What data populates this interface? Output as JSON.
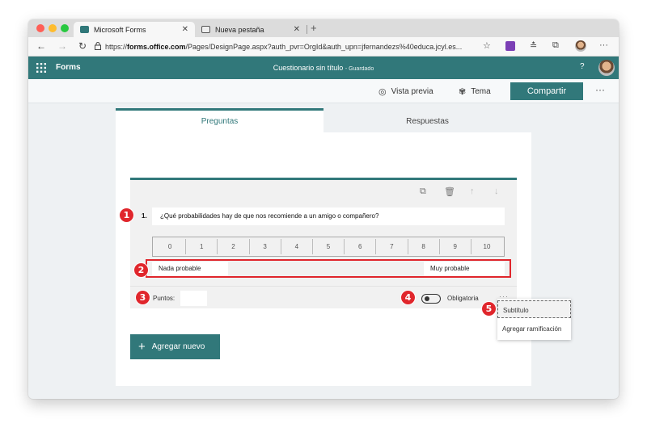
{
  "browser": {
    "tabs": [
      {
        "label": "Microsoft Forms",
        "active": true
      },
      {
        "label": "Nueva pestaña",
        "active": false
      }
    ],
    "new_tab_glyph": "+",
    "url_prefix": "https://",
    "url_host": "forms.office.com",
    "url_rest": "/Pages/DesignPage.aspx?auth_pvr=OrgId&auth_upn=jfernandezs%40educa.jcyl.es..."
  },
  "app": {
    "name": "Forms",
    "doc_title": "Cuestionario sin título",
    "doc_status": "- Guardado",
    "help": "?"
  },
  "commands": {
    "preview": "Vista previa",
    "theme": "Tema",
    "share": "Compartir",
    "more": "···"
  },
  "form_tabs": {
    "questions": "Preguntas",
    "responses": "Respuestas"
  },
  "question": {
    "number": "1.",
    "text": "¿Qué probabilidades hay de que nos recomiende a un amigo o compañero?",
    "scale": [
      "0",
      "1",
      "2",
      "3",
      "4",
      "5",
      "6",
      "7",
      "8",
      "9",
      "10"
    ],
    "low_label": "Nada probable",
    "high_label": "Muy probable",
    "points_label": "Puntos:",
    "points_value": "",
    "required_label": "Obligatoria",
    "required_on": false,
    "more": "···"
  },
  "add_new": "Agregar nuevo",
  "menu": {
    "items": [
      "Subtítulo",
      "Agregar ramificación"
    ]
  },
  "badges": [
    "1",
    "2",
    "3",
    "4",
    "5"
  ],
  "colors": {
    "brand": "#31787a",
    "badge": "#e0262c"
  }
}
